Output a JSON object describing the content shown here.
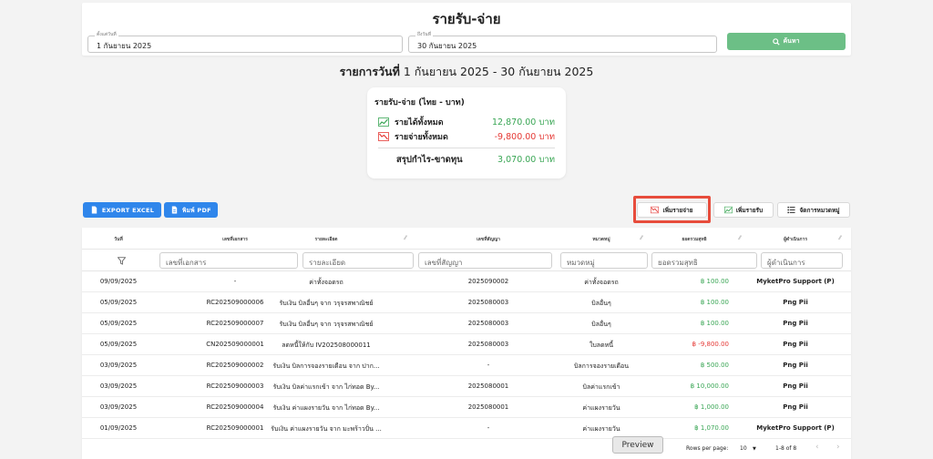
{
  "header": {
    "title": "รายรับ-จ่าย",
    "start_label": "ตั้งแต่วันที่",
    "start_value": "1 กันยายน 2025",
    "end_label": "ถึงวันที่",
    "end_value": "30 กันยายน 2025",
    "search_label": "ค้นหา"
  },
  "range_title": {
    "prefix": "รายการวันที่",
    "range": " 1 กันยายน 2025 - 30 กันยายน 2025"
  },
  "summary": {
    "title": "รายรับ-จ่าย (ไทย - บาท)",
    "income_label": "รายได้ทั้งหมด",
    "income_value": "12,870.00 บาท",
    "expense_label": "รายจ่ายทั้งหมด",
    "expense_value": "-9,800.00 บาท",
    "net_label": "สรุปกำไร-ขาดทุน",
    "net_value": "3,070.00 บาท"
  },
  "toolbar": {
    "export_excel": "EXPORT EXCEL",
    "print_pdf": "พิมพ์ PDF",
    "add_expense": "เพิ่มรายจ่าย",
    "add_income": "เพิ่มรายรับ",
    "manage_categories": "จัดการหมวดหมู่"
  },
  "colors": {
    "income": "#3aa655",
    "expense": "#e53935",
    "primary": "#2f86eb",
    "search": "#6cbf86",
    "highlight": "#e74c3c"
  },
  "table": {
    "columns": [
      "วันที่",
      "เลขที่เอกสาร",
      "รายละเอียด",
      "เลขที่สัญญา",
      "หมวดหมู่",
      "ยอดรวมสุทธิ",
      "ผู้ดำเนินการ"
    ],
    "filters": [
      "เลขที่เอกสาร",
      "รายละเอียด",
      "เลขที่สัญญา",
      "หมวดหมู่",
      "ยอดรวมสุทธิ",
      "ผู้ดำเนินการ"
    ],
    "rows": [
      {
        "date": "09/09/2025",
        "doc": "-",
        "detail": "ค่าทั้งจอดรถ",
        "contract": "2025090002",
        "category": "ค่าทั้งจอดรถ",
        "amount": "฿ 100.00",
        "type": "income",
        "by": "MyketPro Support (P)"
      },
      {
        "date": "05/09/2025",
        "doc": "RC202509000006",
        "detail": "รับเงิน บิลอื่นๆ จาก วรุจรสพาณิชย์",
        "contract": "2025080003",
        "category": "บิลอื่นๆ",
        "amount": "฿ 100.00",
        "type": "income",
        "by": "Png Pii"
      },
      {
        "date": "05/09/2025",
        "doc": "RC202509000007",
        "detail": "รับเงิน บิลอื่นๆ จาก วรุจรสพาณิชย์",
        "contract": "2025080003",
        "category": "บิลอื่นๆ",
        "amount": "฿ 100.00",
        "type": "income",
        "by": "Png Pii"
      },
      {
        "date": "05/09/2025",
        "doc": "CN202509000001",
        "detail": "ลดหนี้ให้กับ IV202508000011",
        "contract": "2025080003",
        "category": "ใบลดหนี้",
        "amount": "฿ -9,800.00",
        "type": "expense",
        "by": "Png Pii"
      },
      {
        "date": "03/09/2025",
        "doc": "RC202509000002",
        "detail": "รับเงิน บิลการจองรายเดือน จาก ปาก...",
        "contract": "-",
        "category": "บิลการจองรายเดือน",
        "amount": "฿ 500.00",
        "type": "income",
        "by": "Png Pii"
      },
      {
        "date": "03/09/2025",
        "doc": "RC202509000003",
        "detail": "รับเงิน บิลค่าแรกเข้า จาก ไก่ทอด By...",
        "contract": "2025080001",
        "category": "บิลค่าแรกเข้า",
        "amount": "฿ 10,000.00",
        "type": "income",
        "by": "Png Pii"
      },
      {
        "date": "03/09/2025",
        "doc": "RC202509000004",
        "detail": "รับเงิน ค่าแผงรายวัน จาก ไก่ทอด By...",
        "contract": "2025080001",
        "category": "ค่าแผงรายวัน",
        "amount": "฿ 1,000.00",
        "type": "income",
        "by": "Png Pii"
      },
      {
        "date": "01/09/2025",
        "doc": "RC202509000001",
        "detail": "รับเงิน ค่าแผงรายวัน จาก มะพร้าวปั่น ...",
        "contract": "-",
        "category": "ค่าแผงรายวัน",
        "amount": "฿ 1,070.00",
        "type": "income",
        "by": "MyketPro Support (P)"
      }
    ]
  },
  "pager": {
    "rows_label": "Rows per page:",
    "rows_value": "10",
    "range": "1-8 of 8"
  },
  "preview_label": "Preview"
}
